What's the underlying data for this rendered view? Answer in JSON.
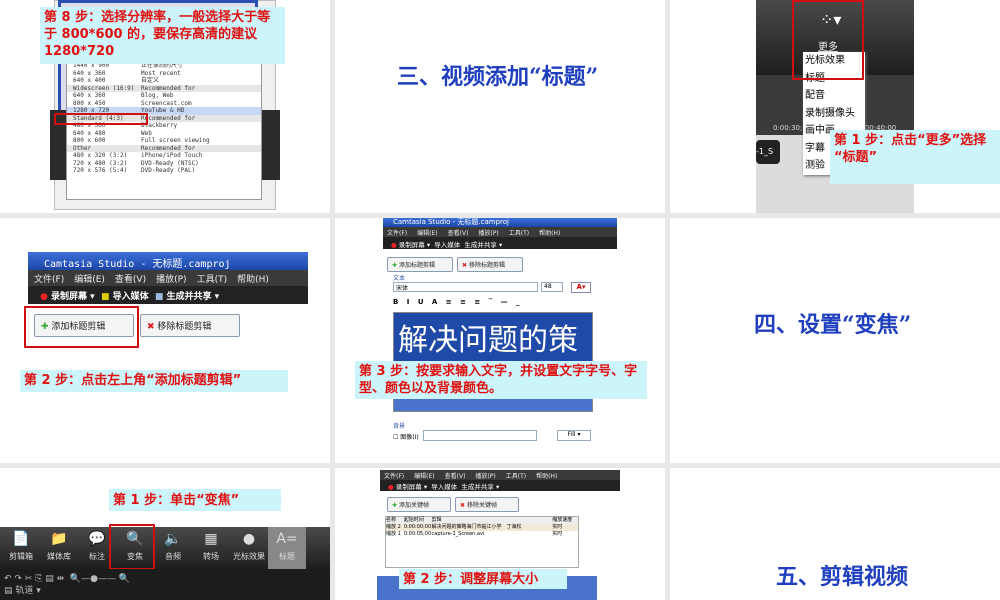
{
  "slide1": {
    "note": "第 8 步：选择分辨率，一般选择大于等于 800*600 的，要保存高清的建议 1280*720",
    "rows": [
      [
        "1440 x 900",
        "正在录制的尺寸"
      ],
      [
        "640 x 360",
        "Most recent"
      ],
      [
        "640 x 400",
        "自定义"
      ],
      [
        "Widescreen (16:9)",
        "Recommended for"
      ],
      [
        "640 x 360",
        "Blog, Web"
      ],
      [
        "800 x 450",
        "Screencast.com"
      ],
      [
        "1280 x 720",
        "YouTube & HD"
      ],
      [
        "Standard (4:3)",
        "Recommended for"
      ],
      [
        "480 x 360",
        "Blackberry"
      ],
      [
        "640 x 480",
        "Web"
      ],
      [
        "800 x 600",
        "Full screen viewing"
      ],
      [
        "Other",
        "Recommended for"
      ],
      [
        "480 x 320 (3:2)",
        "iPhone/iPod Touch"
      ],
      [
        "720 x 480 (3:2)",
        "DVD-Ready (NTSC)"
      ],
      [
        "720 x 576 (5:4)",
        "DVD-Ready (PAL)"
      ]
    ]
  },
  "slide2": {
    "title": "三、视频添加“标题”"
  },
  "slide3": {
    "more": "更多",
    "menu": [
      "光标效果",
      "标题",
      "配音",
      "录制摄像头",
      "画中画",
      "字幕",
      "测验"
    ],
    "time1": "0:00:30;",
    "time2": "0:00:40;00",
    "clip": "-1_S",
    "note": "第 1 步：点击“更多”选择 “标题”"
  },
  "slide4": {
    "app_title": "Camtasia Studio - 无标题.camproj",
    "menu": [
      "文件(F)",
      "编辑(E)",
      "查看(V)",
      "播放(P)",
      "工具(T)",
      "帮助(H)"
    ],
    "toolbar": [
      "录制屏幕 ▾",
      "导入媒体",
      "生成并共享 ▾"
    ],
    "add": "添加标题剪辑",
    "remove": "移除标题剪辑",
    "note": "第 2 步：点击左上角“添加标题剪辑”"
  },
  "slide5": {
    "app_title": "Camtasia Studio - 无标题.camproj",
    "menu": [
      "文件(F)",
      "编辑(E)",
      "查看(V)",
      "播放(P)",
      "工具(T)",
      "帮助(H)"
    ],
    "toolbar": [
      "录制屏幕 ▾",
      "导入媒体",
      "生成并共享 ▾"
    ],
    "add": "添加标题剪辑",
    "remove": "移除标题剪辑",
    "text_group": "文本",
    "font": "宋体",
    "size": "48",
    "preview": "解决问题的策",
    "bg_group": "背景",
    "image_label": "图像(I)",
    "fill": "Fill ▾",
    "note": "第 3 步：按要求输入文字，并设置文字字号、字型、颜色以及背景颜色。"
  },
  "slide6": {
    "title": "四、设置“变焦”"
  },
  "slide7": {
    "note": "第 1 步：单击“变焦”",
    "tools": [
      "剪辑箱",
      "媒体库",
      "标注",
      "变焦",
      "音频",
      "转场",
      "光标效果",
      "标题"
    ],
    "track": "轨道"
  },
  "slide8": {
    "menu": [
      "文件(F)",
      "编辑(E)",
      "查看(V)",
      "播放(P)",
      "工具(T)",
      "帮助(H)"
    ],
    "toolbar": [
      "录制屏幕 ▾",
      "导入媒体",
      "生成并共享 ▾"
    ],
    "add": "添加关键帧",
    "remove": "移除关键帧",
    "headers": [
      "名称",
      "起始时间",
      "剪辑",
      "缩放速度"
    ],
    "rows": [
      [
        "缩放 2",
        "0:00:00;00",
        "解决问题的策略海门市临江小学　丁海松",
        "实时"
      ],
      [
        "缩放 1",
        "0:00:05;00",
        "capture-1_Screen.avi",
        "实时"
      ]
    ],
    "note": "第 2 步：调整屏幕大小"
  },
  "slide9": {
    "title": "五、剪辑视频"
  },
  "colors": {
    "title": "#1f3fbf",
    "note_text": "#e01010",
    "note_bg": "#ccf5fb"
  }
}
